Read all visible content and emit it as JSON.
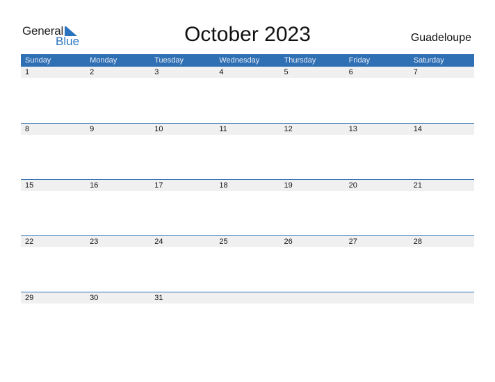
{
  "logo": {
    "word1": "General",
    "word2": "Blue"
  },
  "title": "October 2023",
  "region": "Guadeloupe",
  "colors": {
    "accent": "#2f6fb3",
    "strip": "#f0f0f0"
  },
  "weekdays": [
    "Sunday",
    "Monday",
    "Tuesday",
    "Wednesday",
    "Thursday",
    "Friday",
    "Saturday"
  ],
  "weeks": [
    [
      "1",
      "2",
      "3",
      "4",
      "5",
      "6",
      "7"
    ],
    [
      "8",
      "9",
      "10",
      "11",
      "12",
      "13",
      "14"
    ],
    [
      "15",
      "16",
      "17",
      "18",
      "19",
      "20",
      "21"
    ],
    [
      "22",
      "23",
      "24",
      "25",
      "26",
      "27",
      "28"
    ],
    [
      "29",
      "30",
      "31",
      "",
      "",
      "",
      ""
    ]
  ]
}
